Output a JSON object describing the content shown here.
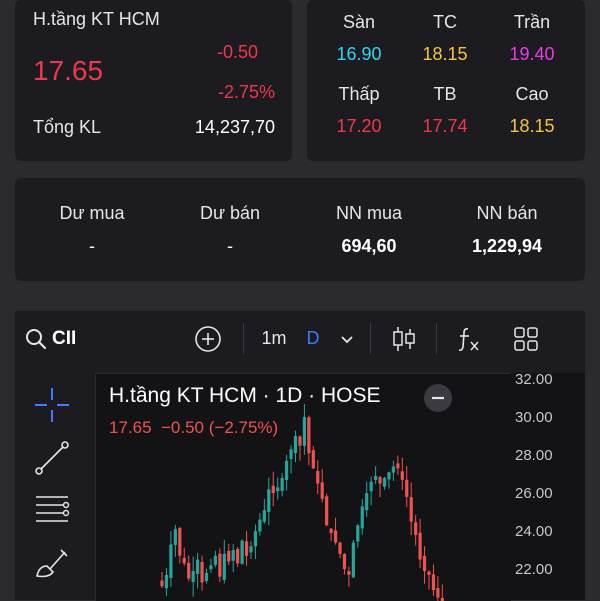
{
  "quote": {
    "name": "H.tầng KT HCM",
    "price": "17.65",
    "change": "-0.50",
    "change_pct": "-2.75%",
    "volume_label": "Tổng KL",
    "volume": "14,237,70"
  },
  "levels": {
    "floor_label": "Sàn",
    "floor": "16.90",
    "ref_label": "TC",
    "ref": "18.15",
    "ceil_label": "Trần",
    "ceil": "19.40",
    "low_label": "Thấp",
    "low": "17.20",
    "avg_label": "TB",
    "avg": "17.74",
    "high_label": "Cao",
    "high": "18.15"
  },
  "orders": {
    "buy_label": "Dư mua",
    "buy": "-",
    "sell_label": "Dư bán",
    "sell": "-",
    "nn_buy_label": "NN mua",
    "nn_buy": "694,60",
    "nn_sell_label": "NN bán",
    "nn_sell": "1,229,94"
  },
  "toolbar": {
    "symbol": "CII",
    "interval": "1m",
    "resolution": "D",
    "icons": [
      "search-icon",
      "plus-circle-icon",
      "chevron-down-icon",
      "candlestick-icon",
      "function-icon",
      "grid-icon"
    ]
  },
  "chart": {
    "legend_title": "H.tầng KT HCM · 1D · HOSE",
    "legend_values": "17.65  −0.50 (−2.75%)",
    "left_tools": [
      "crosshair-icon",
      "trendline-icon",
      "fib-lines-icon",
      "brush-icon"
    ],
    "colors": {
      "up": "#26a69a",
      "down": "#ef5350",
      "bg": "#131316"
    }
  },
  "chart_data": {
    "type": "candlestick",
    "title": "H.tầng KT HCM · 1D · HOSE",
    "ylim": [
      20.0,
      32.0
    ],
    "y_ticks": [
      "32.00",
      "30.00",
      "28.00",
      "26.00",
      "24.00",
      "22.00"
    ],
    "close": [
      21.2,
      21.8,
      23.4,
      24.2,
      22.8,
      22.4,
      21.6,
      22.0,
      22.6,
      21.4,
      21.9,
      22.3,
      22.8,
      21.7,
      22.9,
      22.5,
      23.1,
      22.4,
      23.6,
      22.8,
      23.3,
      24.1,
      24.7,
      25.2,
      26.3,
      26.1,
      26.4,
      26.9,
      27.8,
      28.4,
      29.1,
      28.6,
      30.1,
      28.2,
      27.4,
      26.6,
      25.8,
      24.4,
      24.0,
      23.5,
      22.9,
      22.1,
      21.8,
      23.5,
      24.4,
      25.4,
      26.1,
      26.7,
      27.0,
      26.6,
      26.9,
      27.2,
      27.5,
      27.4,
      26.8,
      25.9,
      24.6,
      23.9,
      22.6,
      22.0,
      21.8,
      21.0,
      20.6,
      20.4
    ]
  }
}
